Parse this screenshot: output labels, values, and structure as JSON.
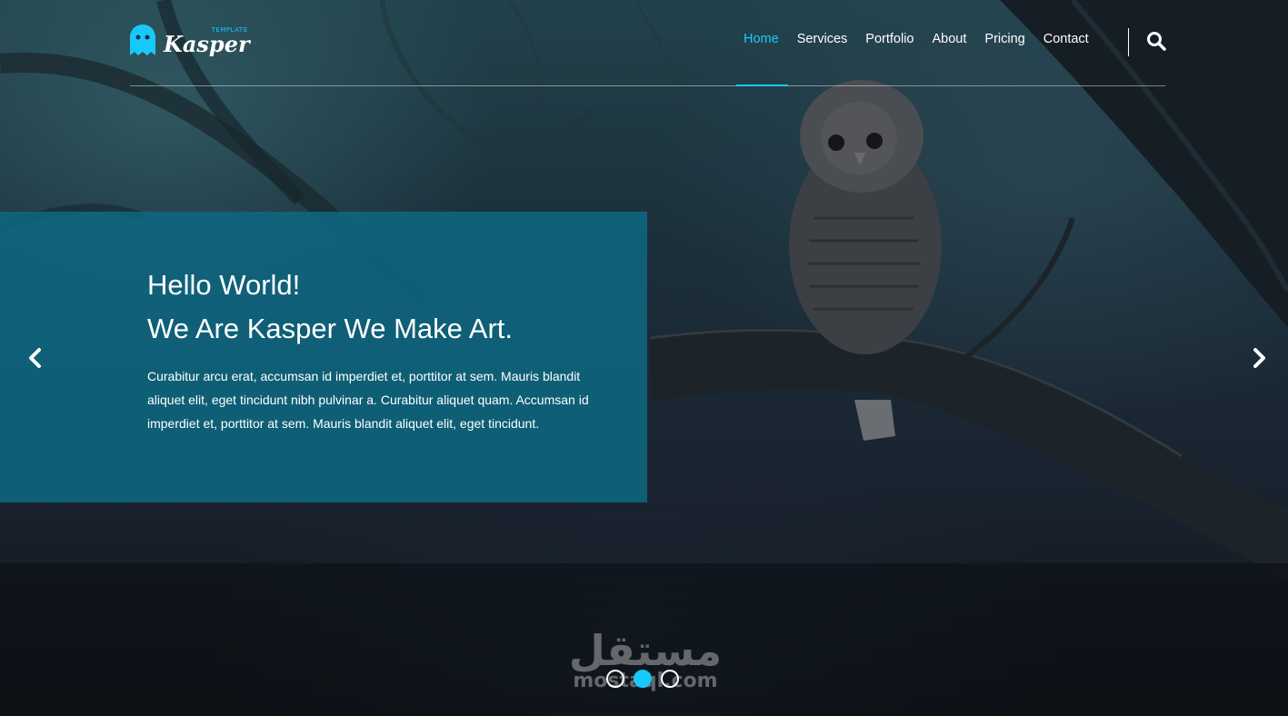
{
  "brand": {
    "name": "Kasper",
    "tagline": "TEMPLATE",
    "accent_color": "#19c8fa"
  },
  "nav": {
    "items": [
      {
        "label": "Home",
        "active": true
      },
      {
        "label": "Services",
        "active": false
      },
      {
        "label": "Portfolio",
        "active": false
      },
      {
        "label": "About",
        "active": false
      },
      {
        "label": "Pricing",
        "active": false
      },
      {
        "label": "Contact",
        "active": false
      }
    ],
    "search_icon": "search-icon"
  },
  "hero": {
    "title_line1": "Hello World!",
    "title_line2": "We Are Kasper We Make Art.",
    "body": "Curabitur arcu erat, accumsan id imperdiet et, porttitor at sem. Mauris blandit aliquet elit, eget tincidunt nibh pulvinar a. Curabitur aliquet quam. Accumsan id imperdiet et, porttitor at sem. Mauris blandit aliquet elit, eget tincidunt.",
    "box_color": "#0d6882",
    "prev_icon": "chevron-left-icon",
    "next_icon": "chevron-right-icon"
  },
  "slider": {
    "bullet_count": 3,
    "active_index": 1
  },
  "watermark": {
    "arabic": "مستقل",
    "latin": "mostaql.com"
  }
}
